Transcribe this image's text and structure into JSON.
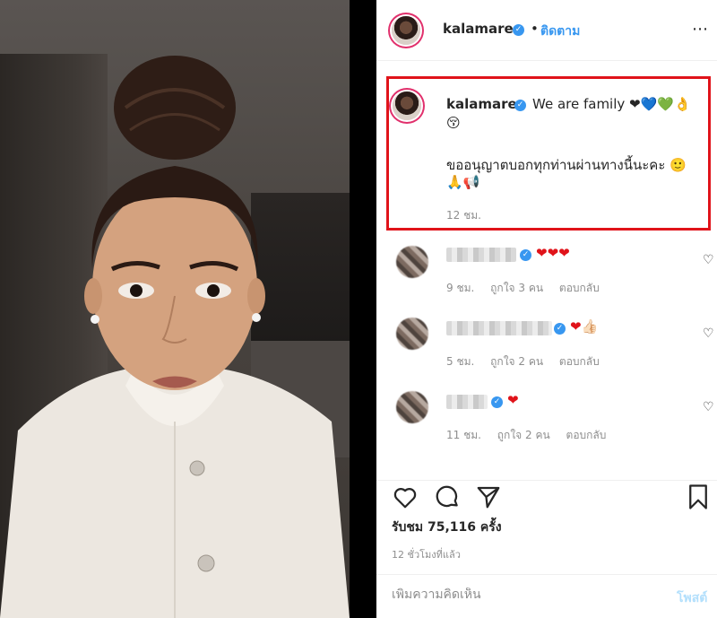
{
  "header": {
    "username": "kalamare",
    "separator": "•",
    "follow_label": "ติดตาม",
    "more_icon": "⋯"
  },
  "caption": {
    "username": "kalamare",
    "line1": "We are family ❤💙💚👌",
    "line1_emoji_tail": "😚",
    "line2": "ขออนุญาตบอกทุกท่านผ่านทางนี้นะคะ 🙂",
    "line2_emoji_tail": "🙏📢",
    "time": "12 ชม."
  },
  "comments": [
    {
      "text": "❤❤❤",
      "time": "9 ชม.",
      "likes": "ถูกใจ 3 คน",
      "reply": "ตอบกลับ"
    },
    {
      "text": "❤👍🏻",
      "time": "5 ชม.",
      "likes": "ถูกใจ 2 คน",
      "reply": "ตอบกลับ"
    },
    {
      "text": "❤",
      "time": "11 ชม.",
      "likes": "ถูกใจ 2 คน",
      "reply": "ตอบกลับ"
    }
  ],
  "actions": {
    "like_icon": "heart-icon",
    "comment_icon": "comment-icon",
    "share_icon": "paper-plane-icon",
    "save_icon": "bookmark-icon"
  },
  "views": "รับชม 75,116 ครั้ง",
  "posted_ago": "12 ชั่วโมงที่แล้ว",
  "add_comment": {
    "placeholder": "เพิ่มความคิดเห็น",
    "post_label": "โพสต์"
  },
  "colors": {
    "verified": "#3897f0",
    "highlight_border": "#e0131a",
    "follow": "#3897f0"
  }
}
